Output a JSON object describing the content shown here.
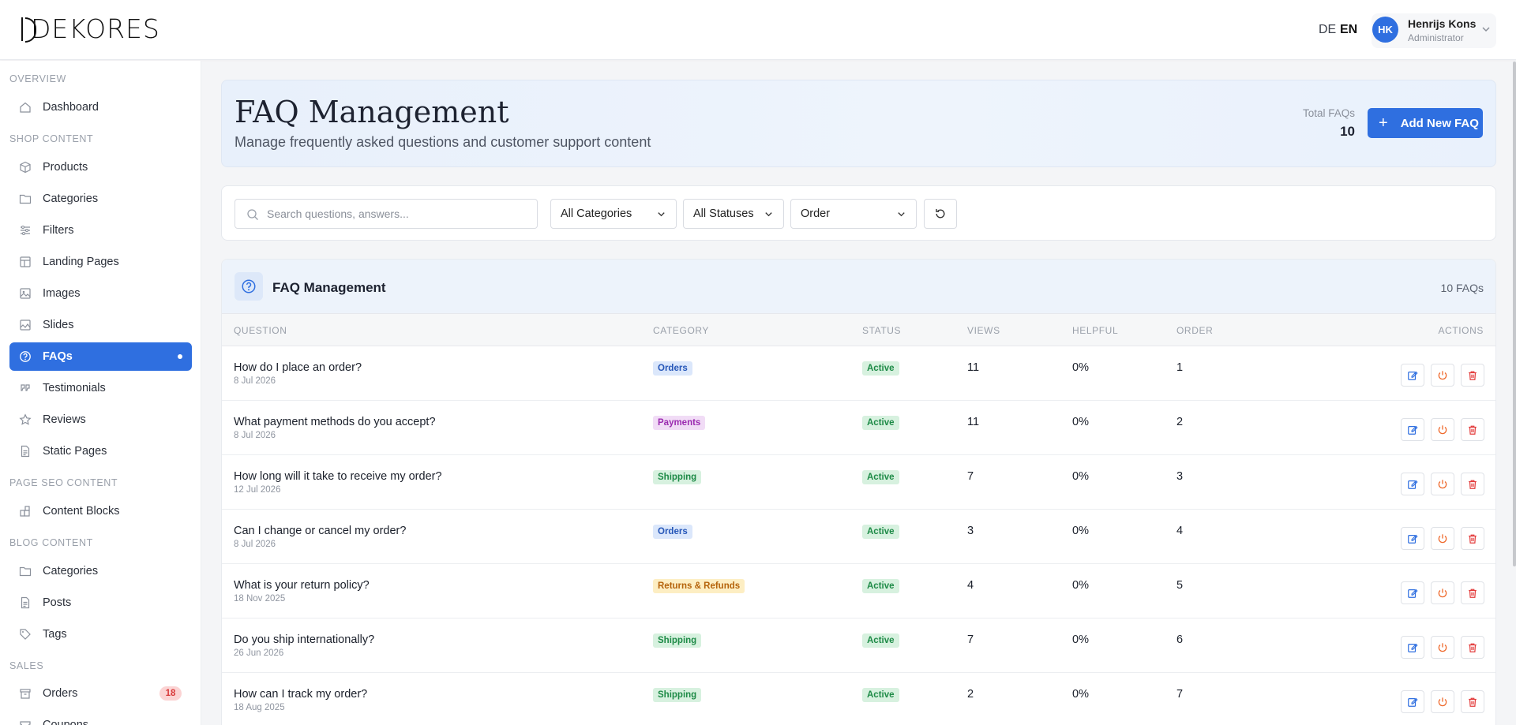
{
  "brand": {
    "logo_text": "DEKORES"
  },
  "header": {
    "lang_de": "DE",
    "lang_en": "EN",
    "user": {
      "initials": "HK",
      "name": "Henrijs Kons",
      "role": "Administrator"
    }
  },
  "sidebar": {
    "sections": {
      "overview": "OVERVIEW",
      "shop": "SHOP CONTENT",
      "seo": "PAGE SEO CONTENT",
      "blog": "BLOG CONTENT",
      "sales": "SALES"
    },
    "items": {
      "dashboard": "Dashboard",
      "products": "Products",
      "categories": "Categories",
      "filters": "Filters",
      "landing": "Landing Pages",
      "images": "Images",
      "slides": "Slides",
      "faqs": "FAQs",
      "testimonials": "Testimonials",
      "reviews": "Reviews",
      "static": "Static Pages",
      "content_blocks": "Content Blocks",
      "blog_categories": "Categories",
      "posts": "Posts",
      "tags": "Tags",
      "orders": "Orders",
      "coupons": "Coupons"
    },
    "orders_badge": "18",
    "accent": "#2f6fe0"
  },
  "hero": {
    "title": "FAQ Management",
    "subtitle": "Manage frequently asked questions and customer support content",
    "total_label": "Total FAQs",
    "total_value": "10",
    "add_button": "Add New FAQ"
  },
  "filters": {
    "search_placeholder": "Search questions, answers...",
    "category": "All Categories",
    "status": "All Statuses",
    "sort": "Order"
  },
  "table": {
    "title": "FAQ Management",
    "count": "10 FAQs",
    "headers": {
      "question": "QUESTION",
      "category": "CATEGORY",
      "status": "STATUS",
      "views": "VIEWS",
      "helpful": "HELPFUL",
      "order": "ORDER",
      "actions": "ACTIONS"
    },
    "rows": [
      {
        "question": "How do I place an order?",
        "date": "8 Jul 2026",
        "category": "Orders",
        "status": "Active",
        "views": "11",
        "helpful": "0%",
        "order": "1"
      },
      {
        "question": "What payment methods do you accept?",
        "date": "8 Jul 2026",
        "category": "Payments",
        "status": "Active",
        "views": "11",
        "helpful": "0%",
        "order": "2"
      },
      {
        "question": "How long will it take to receive my order?",
        "date": "12 Jul 2026",
        "category": "Shipping",
        "status": "Active",
        "views": "7",
        "helpful": "0%",
        "order": "3"
      },
      {
        "question": "Can I change or cancel my order?",
        "date": "8 Jul 2026",
        "category": "Orders",
        "status": "Active",
        "views": "3",
        "helpful": "0%",
        "order": "4"
      },
      {
        "question": "What is your return policy?",
        "date": "18 Nov 2025",
        "category": "Returns & Refunds",
        "status": "Active",
        "views": "4",
        "helpful": "0%",
        "order": "5"
      },
      {
        "question": "Do you ship internationally?",
        "date": "26 Jun 2026",
        "category": "Shipping",
        "status": "Active",
        "views": "7",
        "helpful": "0%",
        "order": "6"
      },
      {
        "question": "How can I track my order?",
        "date": "18 Aug 2025",
        "category": "Shipping",
        "status": "Active",
        "views": "2",
        "helpful": "0%",
        "order": "7"
      }
    ]
  },
  "category_colors": {
    "Orders": {
      "bg": "#dbe7fb",
      "fg": "#2556b8"
    },
    "Payments": {
      "bg": "#f1dcf6",
      "fg": "#9b2bb0"
    },
    "Shipping": {
      "bg": "#d7f1df",
      "fg": "#1d8a46"
    },
    "Returns & Refunds": {
      "bg": "#fdeec3",
      "fg": "#b5630b"
    }
  }
}
